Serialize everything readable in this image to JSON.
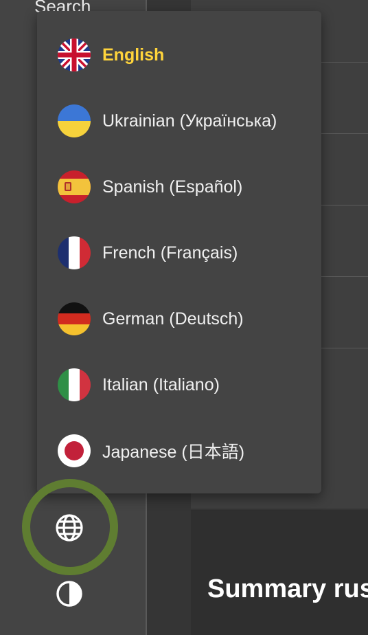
{
  "sidebar": {
    "top_text": "Search"
  },
  "main": {
    "summary_title": "Summary rus"
  },
  "language_menu": {
    "items": [
      {
        "label": "English",
        "flag": "uk-flag-icon",
        "active": true
      },
      {
        "label": "Ukrainian (Українська)",
        "flag": "ukraine-flag-icon",
        "active": false
      },
      {
        "label": "Spanish (Español)",
        "flag": "spain-flag-icon",
        "active": false
      },
      {
        "label": "French (Français)",
        "flag": "france-flag-icon",
        "active": false
      },
      {
        "label": "German (Deutsch)",
        "flag": "germany-flag-icon",
        "active": false
      },
      {
        "label": "Italian (Italiano)",
        "flag": "italy-flag-icon",
        "active": false
      },
      {
        "label": "Japanese (日本語)",
        "flag": "japan-flag-icon",
        "active": false
      }
    ]
  },
  "controls": {
    "language_icon": "globe-icon",
    "theme_icon": "contrast-icon"
  },
  "colors": {
    "active_language": "#ffd43b",
    "focus_ring": "#5f7d31",
    "menu_background": "#444444"
  }
}
